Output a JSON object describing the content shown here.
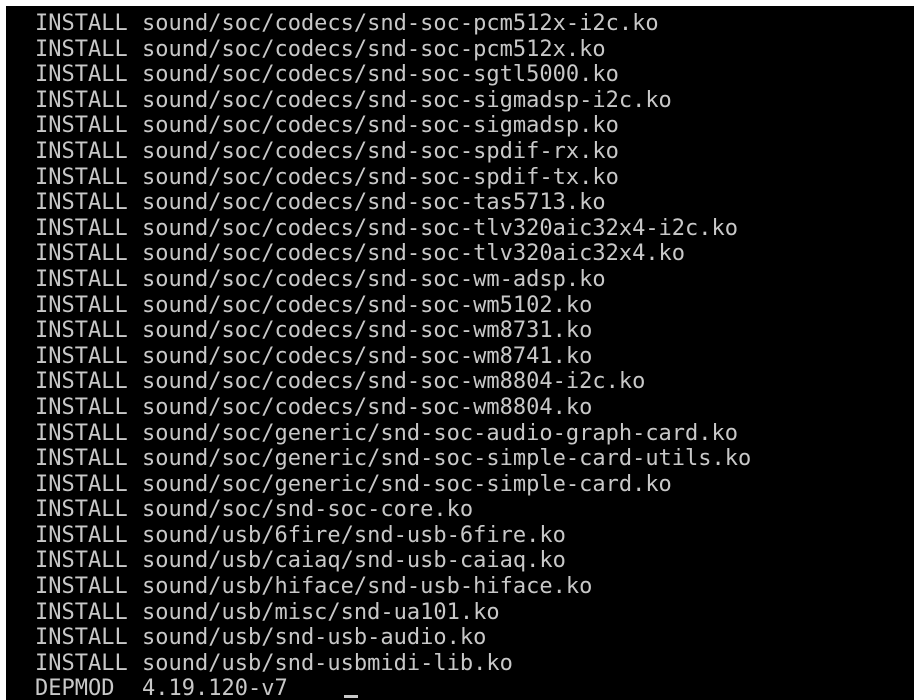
{
  "terminal": {
    "lines": [
      {
        "cmd": "INSTALL",
        "arg": "sound/soc/codecs/snd-soc-pcm512x-i2c.ko"
      },
      {
        "cmd": "INSTALL",
        "arg": "sound/soc/codecs/snd-soc-pcm512x.ko"
      },
      {
        "cmd": "INSTALL",
        "arg": "sound/soc/codecs/snd-soc-sgtl5000.ko"
      },
      {
        "cmd": "INSTALL",
        "arg": "sound/soc/codecs/snd-soc-sigmadsp-i2c.ko"
      },
      {
        "cmd": "INSTALL",
        "arg": "sound/soc/codecs/snd-soc-sigmadsp.ko"
      },
      {
        "cmd": "INSTALL",
        "arg": "sound/soc/codecs/snd-soc-spdif-rx.ko"
      },
      {
        "cmd": "INSTALL",
        "arg": "sound/soc/codecs/snd-soc-spdif-tx.ko"
      },
      {
        "cmd": "INSTALL",
        "arg": "sound/soc/codecs/snd-soc-tas5713.ko"
      },
      {
        "cmd": "INSTALL",
        "arg": "sound/soc/codecs/snd-soc-tlv320aic32x4-i2c.ko"
      },
      {
        "cmd": "INSTALL",
        "arg": "sound/soc/codecs/snd-soc-tlv320aic32x4.ko"
      },
      {
        "cmd": "INSTALL",
        "arg": "sound/soc/codecs/snd-soc-wm-adsp.ko"
      },
      {
        "cmd": "INSTALL",
        "arg": "sound/soc/codecs/snd-soc-wm5102.ko"
      },
      {
        "cmd": "INSTALL",
        "arg": "sound/soc/codecs/snd-soc-wm8731.ko"
      },
      {
        "cmd": "INSTALL",
        "arg": "sound/soc/codecs/snd-soc-wm8741.ko"
      },
      {
        "cmd": "INSTALL",
        "arg": "sound/soc/codecs/snd-soc-wm8804-i2c.ko"
      },
      {
        "cmd": "INSTALL",
        "arg": "sound/soc/codecs/snd-soc-wm8804.ko"
      },
      {
        "cmd": "INSTALL",
        "arg": "sound/soc/generic/snd-soc-audio-graph-card.ko"
      },
      {
        "cmd": "INSTALL",
        "arg": "sound/soc/generic/snd-soc-simple-card-utils.ko"
      },
      {
        "cmd": "INSTALL",
        "arg": "sound/soc/generic/snd-soc-simple-card.ko"
      },
      {
        "cmd": "INSTALL",
        "arg": "sound/soc/snd-soc-core.ko"
      },
      {
        "cmd": "INSTALL",
        "arg": "sound/usb/6fire/snd-usb-6fire.ko"
      },
      {
        "cmd": "INSTALL",
        "arg": "sound/usb/caiaq/snd-usb-caiaq.ko"
      },
      {
        "cmd": "INSTALL",
        "arg": "sound/usb/hiface/snd-usb-hiface.ko"
      },
      {
        "cmd": "INSTALL",
        "arg": "sound/usb/misc/snd-ua101.ko"
      },
      {
        "cmd": "INSTALL",
        "arg": "sound/usb/snd-usb-audio.ko"
      },
      {
        "cmd": "INSTALL",
        "arg": "sound/usb/snd-usbmidi-lib.ko"
      },
      {
        "cmd": "DEPMOD",
        "arg": "4.19.120-v7"
      }
    ]
  },
  "colors": {
    "background": "#000000",
    "text": "#c8c8c8"
  }
}
